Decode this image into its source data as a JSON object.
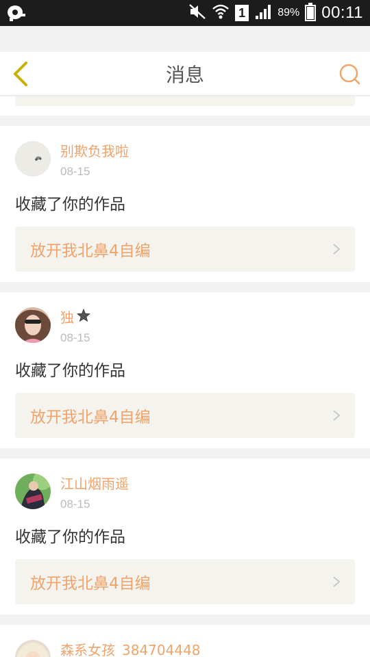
{
  "status_bar": {
    "battery_percent": "89%",
    "battery_level": 0.89,
    "sim_slot": "1",
    "time": "00:11",
    "icons": [
      "app-notification-icon",
      "mute-icon",
      "wifi-icon",
      "signal-icon",
      "battery-icon"
    ]
  },
  "header": {
    "title": "消息",
    "back_icon": "chevron-left-icon",
    "search_icon": "search-icon"
  },
  "colors": {
    "accent": "#f0a36a",
    "back_icon": "#c8b000",
    "card_bg": "#ffffff",
    "link_bg": "#f4f3ee",
    "page_bg": "#f2f2f2"
  },
  "messages": [
    {
      "username": "别欺负我啦",
      "date": "08-15",
      "action": "收藏了你的作品",
      "work_title": "放开我北鼻4自编"
    },
    {
      "username": "独",
      "username_icon": "star-icon",
      "date": "08-15",
      "action": "收藏了你的作品",
      "work_title": "放开我北鼻4自编"
    },
    {
      "username": "江山烟雨遥",
      "date": "08-15",
      "action": "收藏了你的作品",
      "work_title": "放开我北鼻4自编"
    },
    {
      "username": "森系女孩_384704448"
    }
  ]
}
